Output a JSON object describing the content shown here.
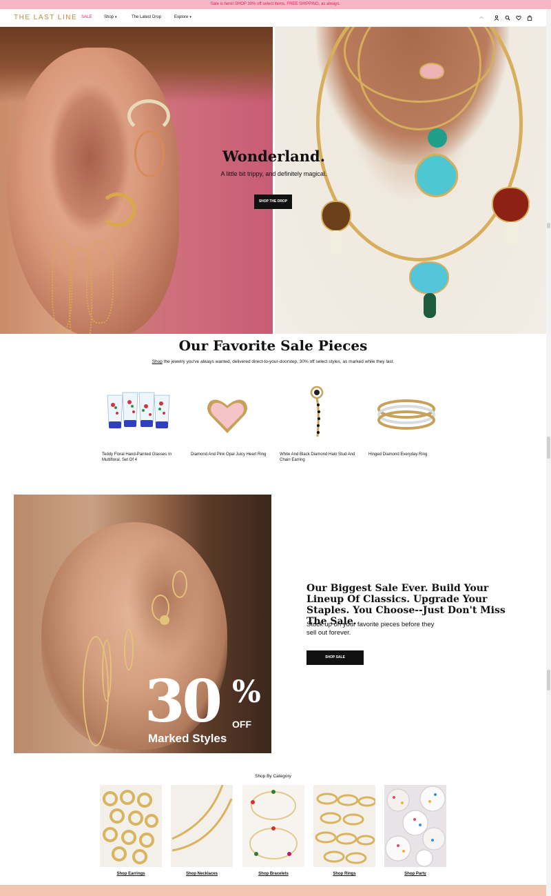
{
  "announcement": "Sale is here! SHOP 30% off select items. FREE SHIPPING, as always.",
  "nav": {
    "logo": "THE LAST LINE",
    "items": [
      {
        "label": "SALE"
      },
      {
        "label": "Shop",
        "caret": "▾"
      },
      {
        "label": "The Latest Drop"
      },
      {
        "label": "Explore",
        "caret": "▾"
      }
    ],
    "icons": [
      "chevron-up-icon",
      "account-icon",
      "search-icon",
      "heart-icon",
      "bag-icon"
    ]
  },
  "hero": {
    "title": "Wonderland.",
    "subtitle": "A little bit trippy, and definitely magical.",
    "button": "SHOP THE DROP"
  },
  "favorites": {
    "title": "Our Favorite Sale Pieces",
    "subtitle_link": "Shop",
    "subtitle_rest": " the jewelry you've always wanted, delivered direct-to-your-doorstep, 30% off select styles, as marked while they last.",
    "products": [
      {
        "name": "Teddy Floral Hand-Painted Glasses In Multifloral, Set Of 4"
      },
      {
        "name": "Diamond And Pink Opal Juicy Heart Ring"
      },
      {
        "name": "White And Black Diamond Halo Stud And Chain Earring"
      },
      {
        "name": "Hinged Diamond Everyday Ring"
      }
    ]
  },
  "promo": {
    "big_number": "30",
    "percent": "%",
    "off": "OFF",
    "marked": "Marked Styles",
    "title": "Our Biggest Sale Ever. Build Your Lineup Of Classics. Upgrade Your Staples. You Choose--Just Don't Miss The Sale.",
    "subtitle": "Stock up on your favorite pieces before they sell out forever.",
    "button": "SHOP SALE"
  },
  "categories": {
    "title": "Shop By Category",
    "items": [
      {
        "label": "Shop Earrings"
      },
      {
        "label": "Shop Necklaces"
      },
      {
        "label": "Shop Bracelets"
      },
      {
        "label": "Shop Rings"
      },
      {
        "label": "Shop Party"
      }
    ]
  },
  "colors": {
    "announcement_bg": "#f7b6c8",
    "sale_accent": "#e0245e",
    "logo_gold": "#c08a3e",
    "button_dark": "#111111"
  }
}
